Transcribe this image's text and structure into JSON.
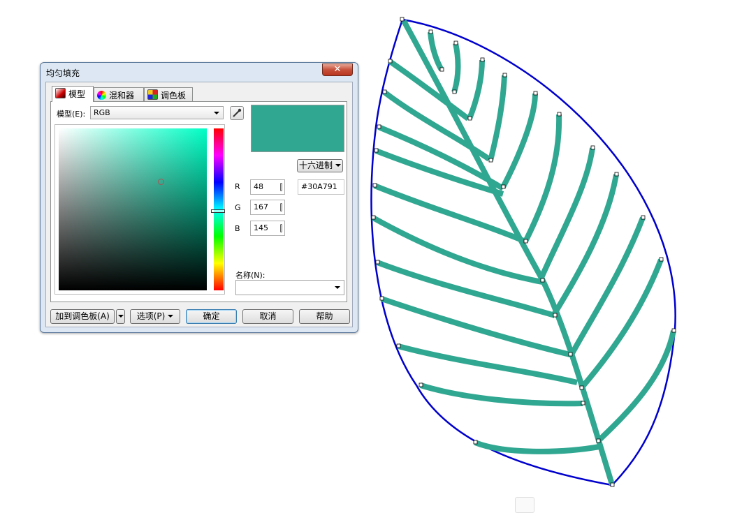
{
  "dialog": {
    "title": "均匀填充",
    "close_glyph": "✕",
    "tabs": [
      {
        "label": "模型",
        "icon": "model-icon"
      },
      {
        "label": "混和器",
        "icon": "mixer-wheel-icon"
      },
      {
        "label": "调色板",
        "icon": "palette-grid-icon"
      }
    ],
    "model_label": "模型(E):",
    "model_value": "RGB",
    "color_hex_value": "#30A791",
    "hex_mode_label": "十六进制",
    "channels": [
      {
        "label": "R",
        "value": "48"
      },
      {
        "label": "G",
        "value": "167"
      },
      {
        "label": "B",
        "value": "145"
      }
    ],
    "name_label": "名称(N):",
    "name_value": "",
    "buttons": {
      "add_to_palette": "加到调色板(A)",
      "options": "选项(P)",
      "ok": "确定",
      "cancel": "取消",
      "help": "帮助"
    }
  },
  "colors": {
    "fill": "#30A791",
    "leaf_outline": "#0000CC",
    "dialog_frame": "#dce7f3"
  }
}
